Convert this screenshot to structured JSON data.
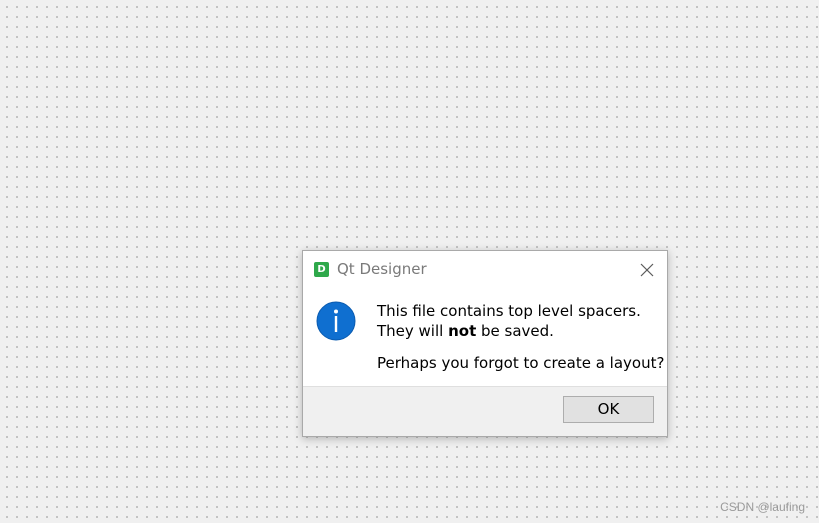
{
  "dialog": {
    "app_icon_letter": "D",
    "title": "Qt Designer",
    "close_icon": "close-icon",
    "info_icon": "information-icon",
    "message": {
      "line1": "This file contains top level spacers.",
      "line2_before": "They will ",
      "line2_bold": "not",
      "line2_after": " be saved.",
      "line3": "Perhaps you forgot to create a layout?"
    },
    "ok_label": "OK"
  },
  "watermark": "CSDN @laufing",
  "colors": {
    "app_icon": "#2ea84a",
    "info_icon": "#0f6fd0",
    "canvas_background": "#f0f0f0"
  }
}
